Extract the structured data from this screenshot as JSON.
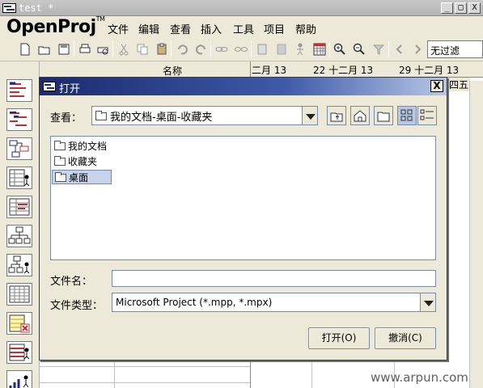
{
  "window": {
    "title": "test *",
    "minimize": "_",
    "maximize": "□",
    "close": "X"
  },
  "app": {
    "logo": "OpenProj",
    "logo_tm": "TM"
  },
  "menu": [
    "文件",
    "编辑",
    "查看",
    "插入",
    "工具",
    "项目",
    "帮助"
  ],
  "toolbar": {
    "filter_value": "无过滤"
  },
  "gantt": {
    "column_name": "名称",
    "timeline": [
      "二月 13",
      "22 十二月 13",
      "29 十二月 13"
    ],
    "weekday_tail": "四五"
  },
  "dialog": {
    "title": "打开",
    "close": "X",
    "look_in_label": "查看：",
    "look_in_value": "我的文档-桌面-收藏夹",
    "items": [
      {
        "label": "我的文档",
        "selected": false
      },
      {
        "label": "收藏夹",
        "selected": false
      },
      {
        "label": "桌面",
        "selected": true
      }
    ],
    "filename_label": "文件名：",
    "filename_value": "",
    "filetype_label": "文件类型：",
    "filetype_value": "Microsoft Project (*.mpp, *.mpx)",
    "open_button": "打开(O)",
    "cancel_button": "撤消(C)"
  },
  "watermark": "www.arpun.com"
}
